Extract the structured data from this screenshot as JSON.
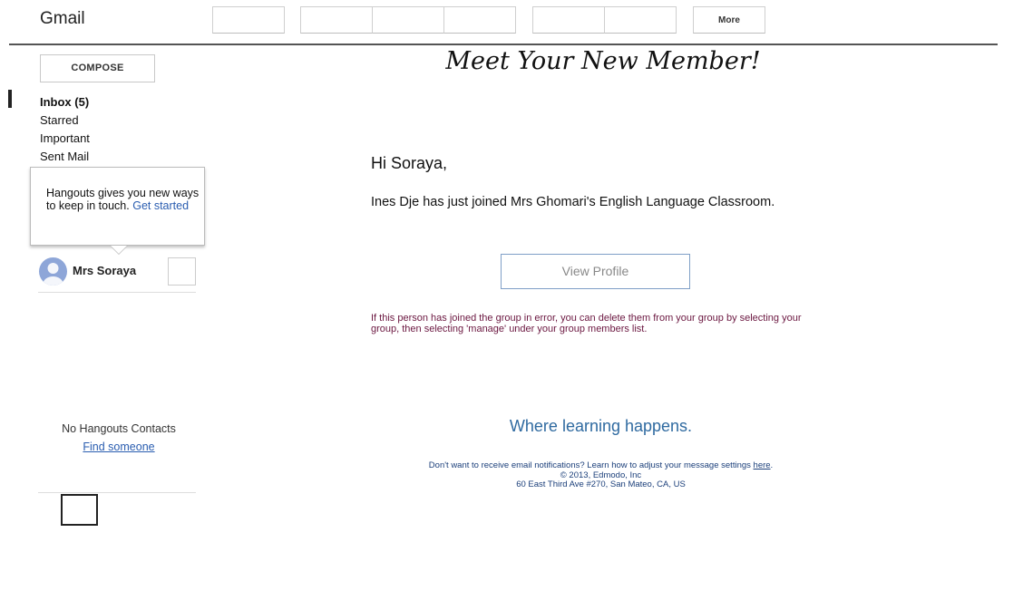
{
  "header": {
    "app_title": "Gmail",
    "more_label": "More"
  },
  "sidebar": {
    "compose_label": "COMPOSE",
    "nav": [
      {
        "label": "Inbox (5)"
      },
      {
        "label": "Starred"
      },
      {
        "label": "Important"
      },
      {
        "label": "Sent Mail"
      }
    ],
    "hangouts_popup": {
      "text": "Hangouts gives you new ways to keep in touch.",
      "link": "Get started"
    },
    "contact": {
      "name": "Mrs Soraya"
    },
    "no_contacts_text": "No Hangouts Contacts",
    "find_link": "Find someone"
  },
  "email": {
    "headline": "Meet Your New Member!",
    "greeting": "Hi Soraya,",
    "body": "Ines Dje has just joined Mrs Ghomari's English Language Classroom.",
    "button_label": "View Profile",
    "note": "If this person has joined the group in error, you can delete them from your group by selecting your group, then selecting 'manage' under your group members list.",
    "tagline": "Where learning happens.",
    "footer": {
      "notify_text": "Don't want to receive email notifications? Learn how to adjust your message settings",
      "notify_link": "here",
      "notify_end": ".",
      "copyright": "© 2013, Edmodo, Inc",
      "address": "60 East Third Ave #270, San Mateo, CA, US"
    }
  },
  "colors": {
    "link": "#2a5db0",
    "note": "#6b1740",
    "tagline": "#2f6aa0",
    "button_border": "#7f9fc7"
  }
}
